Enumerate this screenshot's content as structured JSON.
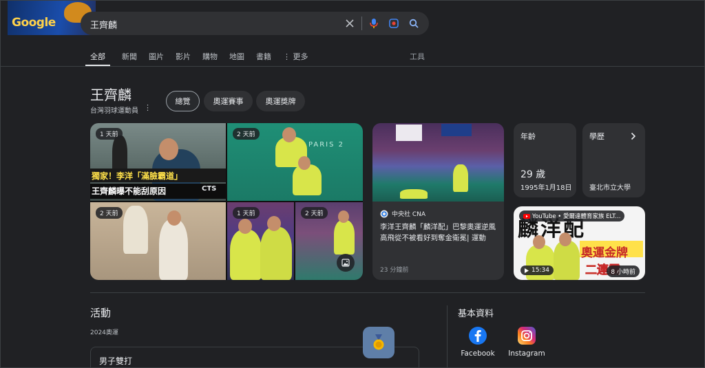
{
  "search": {
    "query": "王齊麟"
  },
  "tabs": [
    {
      "label": "全部"
    },
    {
      "label": "新聞"
    },
    {
      "label": "圖片"
    },
    {
      "label": "影片"
    },
    {
      "label": "購物"
    },
    {
      "label": "地圖"
    },
    {
      "label": "書籍"
    },
    {
      "label": "更多"
    }
  ],
  "tools_label": "工具",
  "entity": {
    "title": "王齊麟",
    "subtitle": "台灣羽球運動員"
  },
  "chips": [
    {
      "label": "總覽"
    },
    {
      "label": "奧運賽事"
    },
    {
      "label": "奧運獎牌"
    }
  ],
  "images": [
    {
      "age": "1 天前",
      "caption1": "獨家！李洋「滿臉霸道」",
      "caption2": "王齊麟曝不能刮原因",
      "logo": "CTS"
    },
    {
      "age": "2 天前",
      "overlay": "PARIS 2"
    },
    {
      "age": "2 天前"
    },
    {
      "age": "1 天前"
    },
    {
      "age": "2 天前"
    }
  ],
  "news": {
    "source": "中央社 CNA",
    "title": "李洋王齊麟「麟洋配」巴黎奧運逆風高飛從不被看好到奪金衛冕| 運動",
    "time": "23 分鐘前"
  },
  "age_card": {
    "label": "年齡",
    "value": "29 歲",
    "date": "1995年1月18日"
  },
  "edu_card": {
    "label": "學歷",
    "value": "臺北市立大學"
  },
  "video": {
    "channel": "YouTube • 愛爾達體育家族 ELT...",
    "duration": "15:34",
    "age": "8 小時前",
    "thumb_top": "麟洋配",
    "thumb_bottom1": "奧運金牌",
    "thumb_bottom2": "二連霸"
  },
  "activity": {
    "title": "活動",
    "subtitle": "2024奧運",
    "event": "男子雙打"
  },
  "profiles": {
    "title": "基本資料",
    "items": [
      {
        "label": "Facebook"
      },
      {
        "label": "Instagram"
      }
    ]
  },
  "colors": {
    "background": "#202124",
    "card": "#303134",
    "chip_border": "#9aa0a6"
  }
}
